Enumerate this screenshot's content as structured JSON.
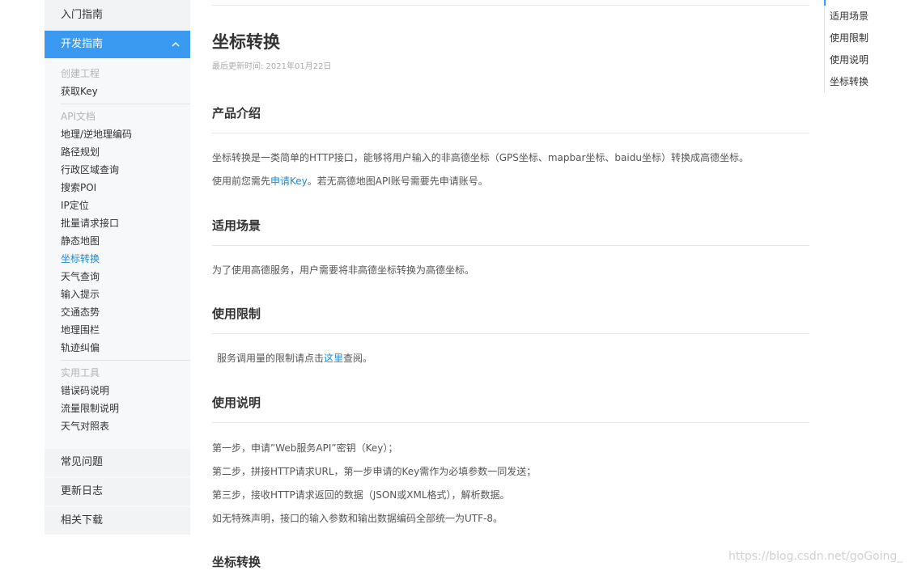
{
  "sidebar": {
    "top_item": "入门指南",
    "active_section": "开发指南",
    "groups": [
      {
        "title": "创建工程",
        "items": [
          "获取Key"
        ]
      },
      {
        "title": "API文档",
        "items": [
          "地理/逆地理编码",
          "路径规划",
          "行政区域查询",
          "搜索POI",
          "IP定位",
          "批量请求接口",
          "静态地图",
          "坐标转换",
          "天气查询",
          "输入提示",
          "交通态势",
          "地理围栏",
          "轨迹纠偏"
        ]
      },
      {
        "title": "实用工具",
        "items": [
          "错误码说明",
          "流量限制说明",
          "天气对照表"
        ]
      }
    ],
    "current_item": "坐标转换",
    "bottom_items": [
      "常见问题",
      "更新日志",
      "相关下载"
    ]
  },
  "main": {
    "title": "坐标转换",
    "updated": "最后更新时间: 2021年01月22日",
    "sections": {
      "intro": {
        "heading": "产品介绍",
        "p1": "坐标转换是一类简单的HTTP接口，能够将用户输入的非高德坐标（GPS坐标、mapbar坐标、baidu坐标）转换成高德坐标。",
        "p2_before": "使用前您需先",
        "p2_link": "申请Key",
        "p2_after": "。若无高德地图API账号需要先申请账号。"
      },
      "scenario": {
        "heading": "适用场景",
        "p1": "为了使用高德服务，用户需要将非高德坐标转换为高德坐标。"
      },
      "limits": {
        "heading": "使用限制",
        "p_before": "服务调用量的限制请点击",
        "p_link": "这里",
        "p_after": "查阅。"
      },
      "usage": {
        "heading": "使用说明",
        "steps": [
          "第一步，申请”Web服务API”密钥（Key）；",
          "第二步，拼接HTTP请求URL，第一步申请的Key需作为必填参数一同发送；",
          "第三步，接收HTTP请求返回的数据（JSON或XML格式），解析数据。",
          "如无特殊声明，接口的输入参数和输出数据编码全部统一为UTF-8。"
        ]
      },
      "convert": {
        "heading": "坐标转换"
      }
    }
  },
  "toc": {
    "items": [
      "适用场景",
      "使用限制",
      "使用说明",
      "坐标转换"
    ]
  },
  "watermark": "https://blog.csdn.net/goGoing_",
  "colors": {
    "accent": "#3a9af2",
    "link": "#1a8ad8"
  }
}
